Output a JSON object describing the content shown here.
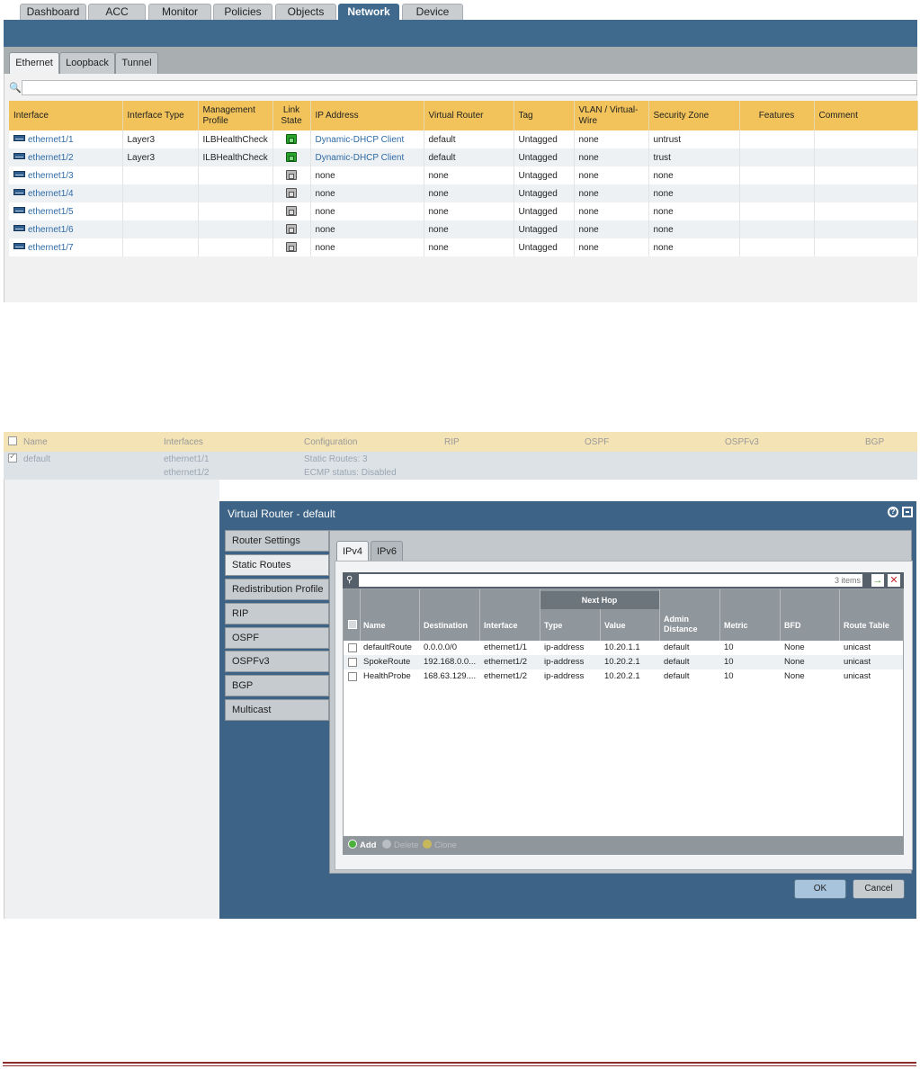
{
  "nav_tabs": [
    "Dashboard",
    "ACC",
    "Monitor",
    "Policies",
    "Objects",
    "Network",
    "Device"
  ],
  "active_nav_tab": "Network",
  "sub_tabs": [
    "Ethernet",
    "Loopback",
    "Tunnel"
  ],
  "active_sub_tab": "Ethernet",
  "interfaces_table": {
    "headers": [
      "Interface",
      "Interface Type",
      "Management Profile",
      "Link State",
      "IP Address",
      "Virtual Router",
      "Tag",
      "VLAN / Virtual-Wire",
      "Security Zone",
      "Features",
      "Comment"
    ],
    "rows": [
      {
        "interface": "ethernet1/1",
        "type": "Layer3",
        "profile": "ILBHealthCheck",
        "link_state": "up",
        "ip": "Dynamic-DHCP Client",
        "router": "default",
        "tag": "Untagged",
        "vlan": "none",
        "zone": "untrust"
      },
      {
        "interface": "ethernet1/2",
        "type": "Layer3",
        "profile": "ILBHealthCheck",
        "link_state": "up",
        "ip": "Dynamic-DHCP Client",
        "router": "default",
        "tag": "Untagged",
        "vlan": "none",
        "zone": "trust"
      },
      {
        "interface": "ethernet1/3",
        "type": "",
        "profile": "",
        "link_state": "down",
        "ip": "none",
        "router": "none",
        "tag": "Untagged",
        "vlan": "none",
        "zone": "none"
      },
      {
        "interface": "ethernet1/4",
        "type": "",
        "profile": "",
        "link_state": "down",
        "ip": "none",
        "router": "none",
        "tag": "Untagged",
        "vlan": "none",
        "zone": "none"
      },
      {
        "interface": "ethernet1/5",
        "type": "",
        "profile": "",
        "link_state": "down",
        "ip": "none",
        "router": "none",
        "tag": "Untagged",
        "vlan": "none",
        "zone": "none"
      },
      {
        "interface": "ethernet1/6",
        "type": "",
        "profile": "",
        "link_state": "down",
        "ip": "none",
        "router": "none",
        "tag": "Untagged",
        "vlan": "none",
        "zone": "none"
      },
      {
        "interface": "ethernet1/7",
        "type": "",
        "profile": "",
        "link_state": "down",
        "ip": "none",
        "router": "none",
        "tag": "Untagged",
        "vlan": "none",
        "zone": "none"
      }
    ]
  },
  "virtual_routers": {
    "headers": [
      "Name",
      "Interfaces",
      "Configuration",
      "RIP",
      "OSPF",
      "OSPFv3",
      "BGP"
    ],
    "row": {
      "checked": true,
      "name": "default",
      "interfaces": [
        "ethernet1/1",
        "ethernet1/2"
      ],
      "configuration": [
        "Static Routes: 3",
        "ECMP status: Disabled"
      ]
    }
  },
  "dialog": {
    "title": "Virtual Router - default",
    "sidebar": [
      "Router Settings",
      "Static Routes",
      "Redistribution Profile",
      "RIP",
      "OSPF",
      "OSPFv3",
      "BGP",
      "Multicast"
    ],
    "active_sidebar": "Static Routes",
    "ip_tabs": [
      "IPv4",
      "IPv6"
    ],
    "active_ip_tab": "IPv4",
    "item_count": "3 items",
    "next_hop_label": "Next Hop",
    "columns": [
      "Name",
      "Destination",
      "Interface",
      "Type",
      "Value",
      "Admin Distance",
      "Metric",
      "BFD",
      "Route Table"
    ],
    "routes": [
      {
        "name": "defaultRoute",
        "destination": "0.0.0.0/0",
        "interface": "ethernet1/1",
        "type": "ip-address",
        "value": "10.20.1.1",
        "admin_distance": "default",
        "metric": "10",
        "bfd": "None",
        "route_table": "unicast"
      },
      {
        "name": "SpokeRoute",
        "destination": "192.168.0.0...",
        "interface": "ethernet1/2",
        "type": "ip-address",
        "value": "10.20.2.1",
        "admin_distance": "default",
        "metric": "10",
        "bfd": "None",
        "route_table": "unicast"
      },
      {
        "name": "HealthProbe",
        "destination": "168.63.129....",
        "interface": "ethernet1/2",
        "type": "ip-address",
        "value": "10.20.2.1",
        "admin_distance": "default",
        "metric": "10",
        "bfd": "None",
        "route_table": "unicast"
      }
    ],
    "actions": [
      "Add",
      "Delete",
      "Clone"
    ],
    "ok_label": "OK",
    "cancel_label": "Cancel"
  },
  "colors": {
    "accent_blue": "#3f6a8e",
    "table_header": "#f2c35a",
    "link": "#2d6aa5",
    "link_up": "#28a12d"
  }
}
